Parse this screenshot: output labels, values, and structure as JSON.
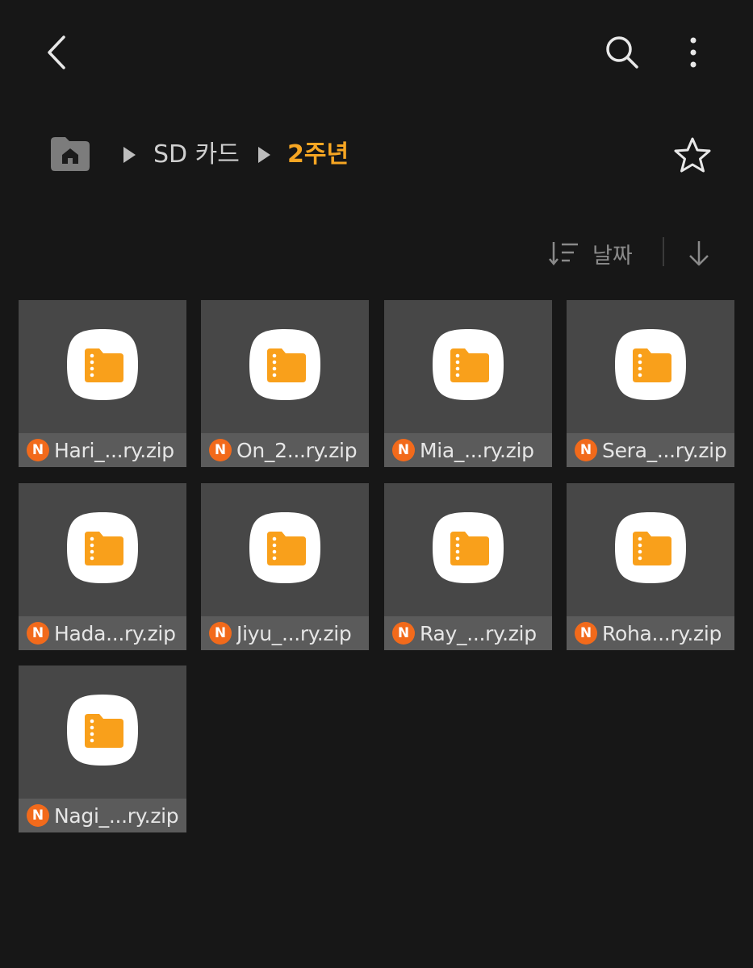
{
  "header": {
    "back_icon": "chevron-left-icon",
    "search_icon": "search-icon",
    "more_icon": "more-vertical-icon"
  },
  "breadcrumb": {
    "home_icon": "home-folder-icon",
    "items": [
      {
        "label": "SD 카드"
      },
      {
        "label": "2주년"
      }
    ],
    "favorite_icon": "star-outline-icon"
  },
  "sort": {
    "label": "날짜",
    "sort_icon": "sort-lines-icon",
    "order_icon": "arrow-down-icon"
  },
  "colors": {
    "background": "#171717",
    "tile": "#474747",
    "tile_label": "#5b5b5b",
    "accent": "#f6a623",
    "badge": "#f26a1b"
  },
  "files": [
    {
      "name": "Hari_...ry.zip",
      "badge": "N"
    },
    {
      "name": "On_2...ry.zip",
      "badge": "N"
    },
    {
      "name": "Mia_...ry.zip",
      "badge": "N"
    },
    {
      "name": "Sera_...ry.zip",
      "badge": "N"
    },
    {
      "name": "Hada...ry.zip",
      "badge": "N"
    },
    {
      "name": "Jiyu_...ry.zip",
      "badge": "N"
    },
    {
      "name": "Ray_...ry.zip",
      "badge": "N"
    },
    {
      "name": "Roha...ry.zip",
      "badge": "N"
    },
    {
      "name": "Nagi_...ry.zip",
      "badge": "N"
    }
  ]
}
